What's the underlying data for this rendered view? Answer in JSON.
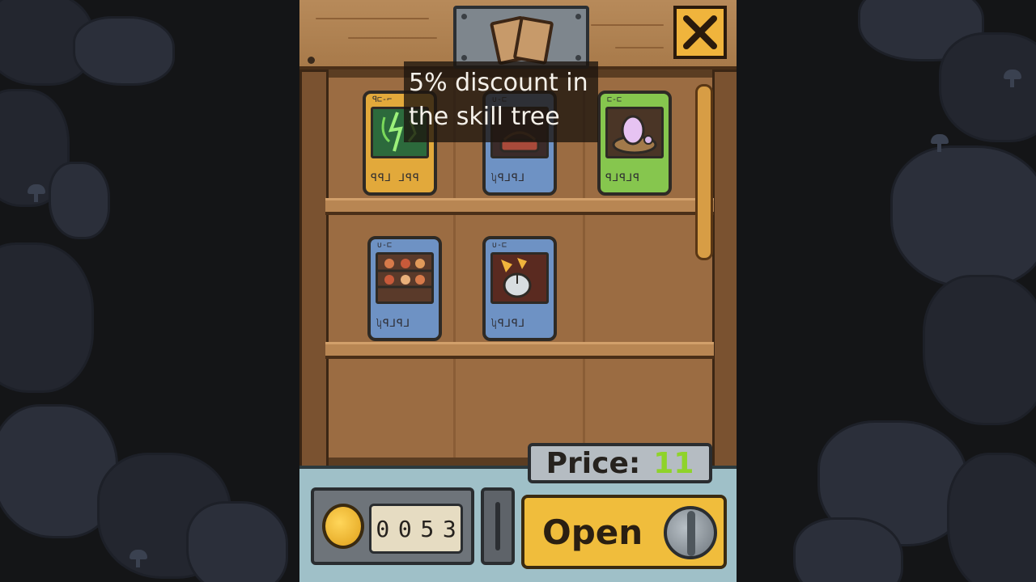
{
  "tooltip": {
    "text": "5% discount in\nthe skill tree"
  },
  "header": {
    "emblem_icon": "cards-icon"
  },
  "close_button": {
    "icon": "close-x-icon"
  },
  "cards": [
    {
      "id": "card-1",
      "rarity": "gold",
      "icon": "lightning-hand-icon",
      "mini": "ꟼ⊏-⌐",
      "runes": "ꟼꟼ⅃ ⅃ꟼꟼ"
    },
    {
      "id": "card-2",
      "rarity": "blue",
      "icon": "cauldron-icon",
      "mini": "∪-⊏",
      "runes": "ʮꟼ⅃ꟼ⅃"
    },
    {
      "id": "card-3",
      "rarity": "green",
      "icon": "egg-nest-icon",
      "mini": "⊏-⊏",
      "runes": "ꟼ⅃ꟼ⅃ꟼ"
    },
    {
      "id": "card-4",
      "rarity": "blue",
      "icon": "potion-shelf-icon",
      "mini": "∪-⊏",
      "runes": "ʮꟼ⅃ꟼ⅃"
    },
    {
      "id": "card-5",
      "rarity": "blue",
      "icon": "mouse-cursor-icon",
      "mini": "∪-⊏",
      "runes": "ʮꟼ⅃ꟼ⅃"
    }
  ],
  "price": {
    "label": "Price:",
    "value": "11"
  },
  "coins": {
    "icon": "coin-icon",
    "digits": [
      "0",
      "0",
      "5",
      "3"
    ]
  },
  "open_button": {
    "label": "Open",
    "icon": "dial-icon"
  },
  "colors": {
    "price_value": "#8fd32a",
    "button": "#f0bd3c",
    "close": "#f0b43c"
  }
}
